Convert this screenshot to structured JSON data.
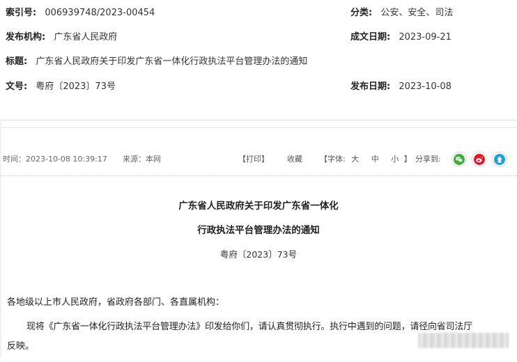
{
  "meta": {
    "index_label": "索引号:",
    "index_value": "006939748/2023-00454",
    "category_label": "分类:",
    "category_value": "公安、安全、司法",
    "publisher_label": "发布机构:",
    "publisher_value": "广东省人民政府",
    "created_label": "成文日期:",
    "created_value": "2023-09-21",
    "title_label": "标题:",
    "title_value": "广东省人民政府关于印发广东省一体化行政执法平台管理办法的通知",
    "docno_label": "文号:",
    "docno_value": "粤府〔2023〕73号",
    "published_label": "发布日期:",
    "published_value": "2023-10-08"
  },
  "infobar": {
    "time": "时间：2023-10-08 10:39:17",
    "source": "来源：本网",
    "print": "【打印】",
    "favorite": "收藏",
    "font_label": "【字体:",
    "font_large": "大",
    "font_medium": "中",
    "font_small": "小",
    "font_close": "】",
    "share_label": "分享到:",
    "share_icons": [
      "wechat-icon",
      "weibo-icon",
      "qq-icon"
    ],
    "colors": {
      "wechat": "#3cb035",
      "weibo": "#e6162d",
      "qq": "#1e9fe0"
    }
  },
  "article": {
    "title_line1": "广东省人民政府关于印发广东省一体化",
    "title_line2": "行政执法平台管理办法的通知",
    "doc_number": "粤府〔2023〕73号",
    "salutation": "各地级以上市人民政府，省政府各部门、各直属机构：",
    "body_line1": "现将《广东省一体化行政执法平台管理办法》印发给你们，请认真贯彻执行。执行中遇到的问题，请径向省司法厅",
    "body_line2": "反映。"
  }
}
